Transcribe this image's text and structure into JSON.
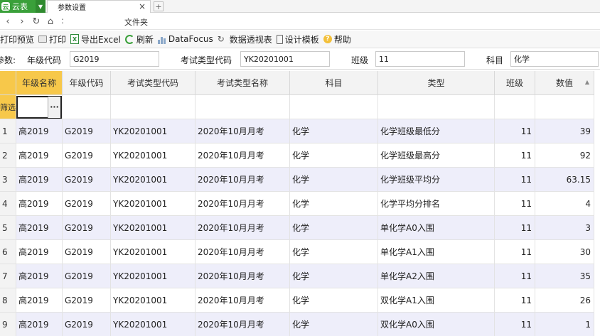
{
  "tabs": {
    "app_label": "云表",
    "app_logo": "云",
    "doc_title": "参数设置",
    "close_glyph": "×",
    "new_tab_glyph": "+"
  },
  "nav": {
    "back": "‹",
    "forward": "›",
    "reload": "↻",
    "home": "⌂",
    "colon": ":",
    "path": "文件夹"
  },
  "toolbar": {
    "print_preview": "打印预览",
    "print": "打印",
    "export_excel": "导出Excel",
    "refresh": "刷新",
    "datafocus": "DataFocus",
    "pivot": "数据透视表",
    "design_template": "设计模板",
    "help": "帮助"
  },
  "params": {
    "prefix": "参数:",
    "grade_code_label": "年级代码",
    "grade_code_value": "G2019",
    "exam_type_code_label": "考试类型代码",
    "exam_type_code_value": "YK20201001",
    "class_label": "班级",
    "class_value": "11",
    "subject_label": "科目",
    "subject_value": "化学"
  },
  "grid": {
    "columns": [
      "年级名称",
      "年级代码",
      "考试类型代码",
      "考试类型名称",
      "科目",
      "类型",
      "班级",
      "数值"
    ],
    "filter_label": "筛选",
    "filter_button": "···",
    "sort_indicator": "▲",
    "rows": [
      {
        "n": "1",
        "grade_name": "高2019",
        "grade_code": "G2019",
        "exam_code": "YK20201001",
        "exam_name": "2020年10月月考",
        "subject": "化学",
        "type": "化学班级最低分",
        "class": "11",
        "value": "39"
      },
      {
        "n": "2",
        "grade_name": "高2019",
        "grade_code": "G2019",
        "exam_code": "YK20201001",
        "exam_name": "2020年10月月考",
        "subject": "化学",
        "type": "化学班级最高分",
        "class": "11",
        "value": "92"
      },
      {
        "n": "3",
        "grade_name": "高2019",
        "grade_code": "G2019",
        "exam_code": "YK20201001",
        "exam_name": "2020年10月月考",
        "subject": "化学",
        "type": "化学班级平均分",
        "class": "11",
        "value": "63.15"
      },
      {
        "n": "4",
        "grade_name": "高2019",
        "grade_code": "G2019",
        "exam_code": "YK20201001",
        "exam_name": "2020年10月月考",
        "subject": "化学",
        "type": "化学平均分排名",
        "class": "11",
        "value": "4"
      },
      {
        "n": "5",
        "grade_name": "高2019",
        "grade_code": "G2019",
        "exam_code": "YK20201001",
        "exam_name": "2020年10月月考",
        "subject": "化学",
        "type": "单化学A0入围",
        "class": "11",
        "value": "3"
      },
      {
        "n": "6",
        "grade_name": "高2019",
        "grade_code": "G2019",
        "exam_code": "YK20201001",
        "exam_name": "2020年10月月考",
        "subject": "化学",
        "type": "单化学A1入围",
        "class": "11",
        "value": "30"
      },
      {
        "n": "7",
        "grade_name": "高2019",
        "grade_code": "G2019",
        "exam_code": "YK20201001",
        "exam_name": "2020年10月月考",
        "subject": "化学",
        "type": "单化学A2入围",
        "class": "11",
        "value": "35"
      },
      {
        "n": "8",
        "grade_name": "高2019",
        "grade_code": "G2019",
        "exam_code": "YK20201001",
        "exam_name": "2020年10月月考",
        "subject": "化学",
        "type": "双化学A1入围",
        "class": "11",
        "value": "26"
      },
      {
        "n": "9",
        "grade_name": "高2019",
        "grade_code": "G2019",
        "exam_code": "YK20201001",
        "exam_name": "2020年10月月考",
        "subject": "化学",
        "type": "双化学A0入围",
        "class": "11",
        "value": "1"
      }
    ]
  },
  "colors": {
    "brand_green": "#3aa03a",
    "active_header": "#f7c84a",
    "alt_row": "#eeeefa"
  }
}
